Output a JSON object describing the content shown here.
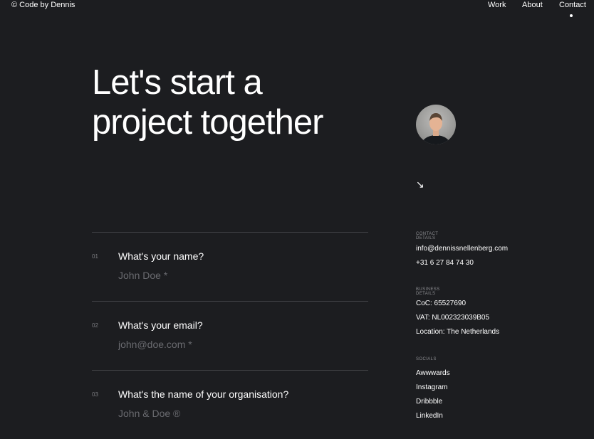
{
  "header": {
    "brand": "© Code by Dennis",
    "nav": [
      "Work",
      "About",
      "Contact"
    ],
    "active_nav": "Contact"
  },
  "hero": {
    "line1": "Let's start a",
    "line2": "project together",
    "arrow_glyph": "↘"
  },
  "form": {
    "fields": [
      {
        "number": "01",
        "question": "What's your name?",
        "placeholder": "John Doe *"
      },
      {
        "number": "02",
        "question": "What's your email?",
        "placeholder": "john@doe.com *"
      },
      {
        "number": "03",
        "question": "What's the name of your organisation?",
        "placeholder": "John & Doe ®"
      }
    ]
  },
  "sidebar": {
    "contact_heading": "CONTACT DETAILS",
    "email": "info@dennissnellenberg.com",
    "phone": "+31 6 27 84 74 30",
    "business_heading": "BUSINESS DETAILS",
    "coc": "CoC: 65527690",
    "vat": "VAT: NL002323039B05",
    "location": "Location: The Netherlands",
    "socials_heading": "SOCIALS",
    "socials": [
      "Awwwards",
      "Instagram",
      "Dribbble",
      "LinkedIn"
    ]
  },
  "colors": {
    "background": "#1c1d20",
    "text": "#ffffff",
    "muted": "#7b7c80",
    "divider": "#3d3e42"
  }
}
